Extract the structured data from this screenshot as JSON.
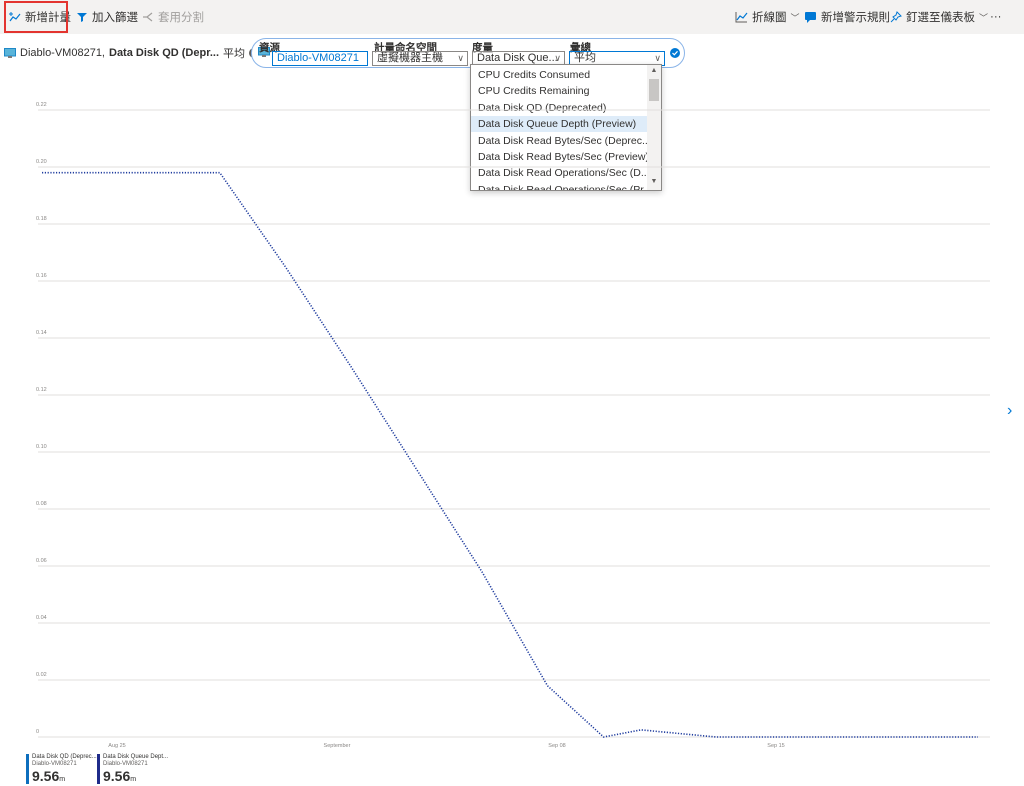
{
  "toolbar": {
    "add_metric": "新增計量",
    "add_filter": "加入篩選",
    "apply_splitting": "套用分割",
    "chart_type": "折線圖",
    "new_alert_rule": "新增警示規則",
    "pin_to_dashboard": "釘選至儀表板",
    "more": "···"
  },
  "series_pill": {
    "resource": "Diablo-VM08271,",
    "metric": "Data Disk QD (Depr...",
    "aggregation": "平均"
  },
  "metric_editor": {
    "resource_label": "資源",
    "resource_value": "Diablo-VM08271",
    "namespace_label": "計量命名空間",
    "namespace_value": "虛擬機器主機",
    "metric_label": "度量",
    "metric_value": "Data Disk Que...",
    "aggregation_label": "彙總",
    "aggregation_value": "平均"
  },
  "metric_dropdown": {
    "items": [
      "CPU Credits Consumed",
      "CPU Credits Remaining",
      "Data Disk QD (Deprecated)",
      "Data Disk Queue Depth (Preview)",
      "Data Disk Read Bytes/Sec (Deprec...",
      "Data Disk Read Bytes/Sec (Preview)",
      "Data Disk Read Operations/Sec (D...",
      "Data Disk Read Operations/Sec (Pr..."
    ],
    "selected_index": 3
  },
  "chart_data": {
    "type": "line",
    "title": "",
    "xlabel": "",
    "ylabel": "",
    "y_ticks": [
      "0",
      "0.02",
      "0.04",
      "0.06",
      "0.08",
      "0.10",
      "0.12",
      "0.14",
      "0.16",
      "0.18",
      "0.20",
      "0.22"
    ],
    "ylim": [
      0,
      0.22
    ],
    "x_ticks": [
      "Aug 25",
      "September",
      "Sep 08",
      "Sep 15"
    ],
    "grid": true,
    "legend_position": "bottom-left",
    "series": [
      {
        "color": "#1f3c9e",
        "style": "dotted",
        "x": [
          0.0,
          0.19,
          0.26,
          0.33,
          0.4,
          0.47,
          0.54,
          0.6,
          0.64,
          0.72,
          0.75,
          1.0
        ],
        "values": [
          0.198,
          0.198,
          0.165,
          0.13,
          0.094,
          0.058,
          0.018,
          0.0,
          0.0025,
          0.0,
          0.0,
          0.0
        ]
      }
    ]
  },
  "legend": [
    {
      "name": "Data Disk QD (Deprec...",
      "resource": "Diablo-VM08271",
      "value": "9.56",
      "unit": "m",
      "color": "#0d6ebd"
    },
    {
      "name": "Data Disk Queue Dept...",
      "resource": "Diablo-VM08271",
      "value": "9.56",
      "unit": "m",
      "color": "#1f2b8a"
    }
  ]
}
